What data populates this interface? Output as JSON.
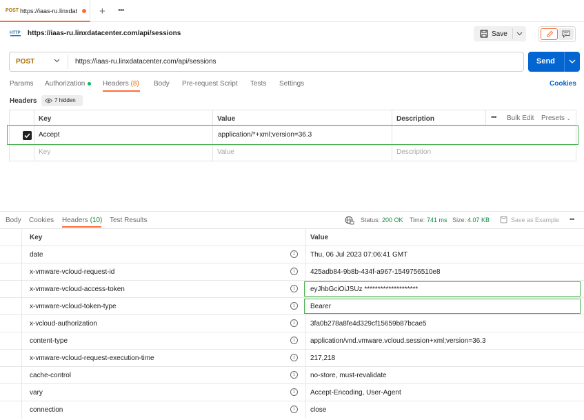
{
  "tab": {
    "method": "POST",
    "title": "https://iaas-ru.linxdat"
  },
  "title_bar": {
    "url_title": "https://iaas-ru.linxdatacenter.com/api/sessions",
    "save_label": "Save"
  },
  "request": {
    "method": "POST",
    "url": "https://iaas-ru.linxdatacenter.com/api/sessions",
    "send_label": "Send"
  },
  "request_tabs": [
    "Params",
    "Authorization",
    "Headers",
    "(8)",
    "Body",
    "Pre-request Script",
    "Tests",
    "Settings"
  ],
  "cookies_label": "Cookies",
  "headers_section": {
    "label": "Headers",
    "hidden": "7 hidden"
  },
  "req_table": {
    "columns": [
      "Key",
      "Value",
      "Description"
    ],
    "bulk_edit": "Bulk Edit",
    "presets": "Presets",
    "row": {
      "key": "Accept",
      "value": "application/*+xml;version=36.3"
    },
    "placeholder": {
      "key": "Key",
      "value": "Value",
      "description": "Description"
    }
  },
  "response_tabs": [
    "Body",
    "Cookies",
    "Headers",
    "(10)",
    "Test Results"
  ],
  "status": {
    "status_label": "Status:",
    "status_value": "200 OK",
    "time_label": "Time:",
    "time_value": "741 ms",
    "size_label": "Size:",
    "size_value": "4.07 KB",
    "save_example": "Save as Example"
  },
  "resp_table": {
    "columns": [
      "Key",
      "Value"
    ],
    "rows": [
      {
        "key": "date",
        "value": "Thu, 06 Jul 2023 07:06:41 GMT"
      },
      {
        "key": "x-vmware-vcloud-request-id",
        "value": "425adb84-9b8b-434f-a967-1549756510e8"
      },
      {
        "key": "x-vmware-vcloud-access-token",
        "value": "eyJhbGciOiJSUz ********************"
      },
      {
        "key": "x-vmware-vcloud-token-type",
        "value": "Bearer"
      },
      {
        "key": "x-vcloud-authorization",
        "value": "3fa0b278a8fe4d329cf15659b87bcae5"
      },
      {
        "key": "content-type",
        "value": "application/vnd.vmware.vcloud.session+xml;version=36.3"
      },
      {
        "key": "x-vmware-vcloud-request-execution-time",
        "value": "217,218"
      },
      {
        "key": "cache-control",
        "value": "no-store, must-revalidate"
      },
      {
        "key": "vary",
        "value": "Accept-Encoding, User-Agent"
      },
      {
        "key": "connection",
        "value": "close"
      }
    ]
  },
  "colors": {
    "accent": "#ff6c37",
    "send": "#0265d2",
    "method": "#a76f00",
    "highlight": "#4caf50"
  }
}
